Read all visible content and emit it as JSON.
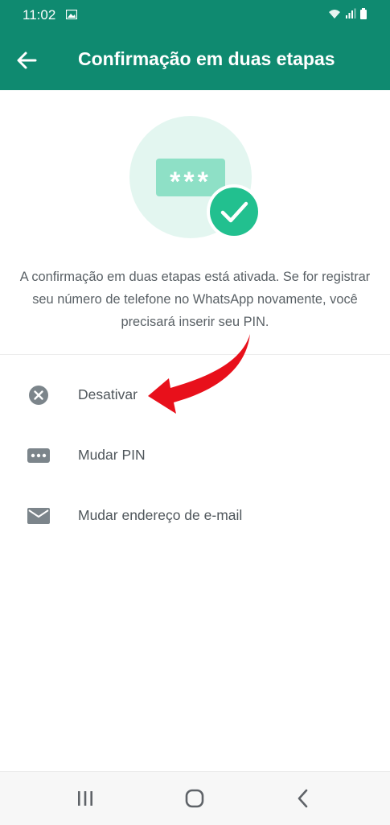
{
  "status_bar": {
    "time": "11:02",
    "icons": [
      "image-icon",
      "wifi-icon",
      "signal-icon",
      "battery-icon"
    ]
  },
  "app_bar": {
    "title": "Confirmação em duas etapas",
    "back_icon": "arrow-back-icon"
  },
  "hero": {
    "pin_mask": "***",
    "icon": "check-icon"
  },
  "info": {
    "text": "A confirmação em duas etapas está ativada. Se for registrar seu número de telefone no WhatsApp novamente, você precisará inserir seu PIN."
  },
  "menu": {
    "items": [
      {
        "label": "Desativar",
        "icon": "cancel-circle-icon"
      },
      {
        "label": "Mudar PIN",
        "icon": "pin-dots-icon"
      },
      {
        "label": "Mudar endereço de e-mail",
        "icon": "mail-icon"
      }
    ]
  },
  "nav_bar": {
    "buttons": [
      "recent-apps-icon",
      "home-icon",
      "back-nav-icon"
    ]
  },
  "colors": {
    "primary": "#0f8a70",
    "accent": "#22c08f",
    "hero_circle": "#e3f6f0",
    "pin_box": "#8ee0c6",
    "icon_gray": "#7c858b",
    "annotation_red": "#e8101b"
  }
}
